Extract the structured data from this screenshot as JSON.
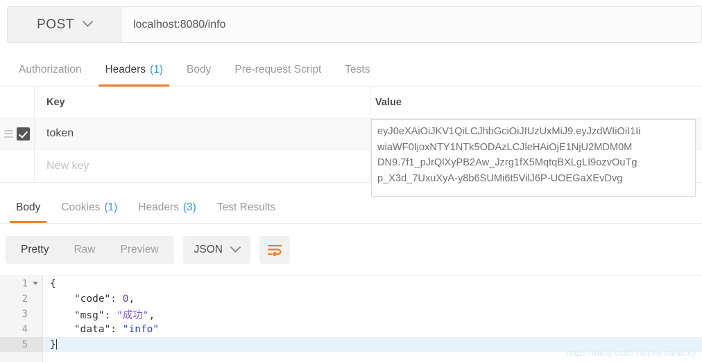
{
  "request": {
    "method": "POST",
    "url": "localhost:8080/info",
    "tabs": [
      {
        "label": "Authorization",
        "count": "",
        "active": false
      },
      {
        "label": "Headers",
        "count": "(1)",
        "active": true
      },
      {
        "label": "Body",
        "count": "",
        "active": false
      },
      {
        "label": "Pre-request Script",
        "count": "",
        "active": false
      },
      {
        "label": "Tests",
        "count": "",
        "active": false
      }
    ],
    "headers_table": {
      "columns": {
        "key": "Key",
        "value": "Value"
      },
      "rows": [
        {
          "checked": true,
          "key": "token",
          "value_lines": [
            "eyJ0eXAiOiJKV1QiLCJhbGciOiJIUzUxMiJ9.eyJzdWIiOiI1Ii",
            "wiaWF0IjoxNTY1NTk5ODAzLCJleHAiOjE1NjU2MDM0M",
            "DN9.7f1_pJrQlXyPB2Aw_Jzrg1fX5MqtqBXLgLI9ozvOuTg",
            "p_X3d_7UxuXyA-y8b6SUMi6t5VilJ6P-UOEGaXEvDvg"
          ]
        }
      ],
      "new_row_placeholder": "New key"
    }
  },
  "response": {
    "tabs": [
      {
        "label": "Body",
        "count": "",
        "active": true
      },
      {
        "label": "Cookies",
        "count": "(1)",
        "active": false
      },
      {
        "label": "Headers",
        "count": "(3)",
        "active": false
      },
      {
        "label": "Test Results",
        "count": "",
        "active": false
      }
    ],
    "view_modes": [
      {
        "label": "Pretty",
        "active": true
      },
      {
        "label": "Raw",
        "active": false
      },
      {
        "label": "Preview",
        "active": false
      }
    ],
    "format": "JSON",
    "wrap_icon": "wrap-lines-icon",
    "body": {
      "language": "json",
      "lines": [
        {
          "number": "1",
          "foldable": true,
          "current": false,
          "segments": [
            {
              "t": "{",
              "c": "tok-key"
            }
          ]
        },
        {
          "number": "2",
          "foldable": false,
          "current": false,
          "segments": [
            {
              "t": "    \"code\": ",
              "c": "tok-key"
            },
            {
              "t": "0",
              "c": "tok-num"
            },
            {
              "t": ",",
              "c": "tok-key"
            }
          ]
        },
        {
          "number": "3",
          "foldable": false,
          "current": false,
          "segments": [
            {
              "t": "    \"msg\": ",
              "c": "tok-key"
            },
            {
              "t": "\"成功\"",
              "c": "tok-cjk"
            },
            {
              "t": ",",
              "c": "tok-key"
            }
          ]
        },
        {
          "number": "4",
          "foldable": false,
          "current": false,
          "segments": [
            {
              "t": "    \"data\": ",
              "c": "tok-key"
            },
            {
              "t": "\"info\"",
              "c": "tok-str"
            }
          ]
        },
        {
          "number": "5",
          "foldable": false,
          "current": true,
          "segments": [
            {
              "t": "}",
              "c": "tok-key"
            }
          ]
        }
      ]
    }
  },
  "watermark": "https://blog.csdn.net/AkiraNicky",
  "colors": {
    "accent": "#ef7d27",
    "link": "#2e9bd6",
    "string": "#1f3fd6",
    "number": "#6a3ab2",
    "cjk_string": "#7b5bd1"
  }
}
